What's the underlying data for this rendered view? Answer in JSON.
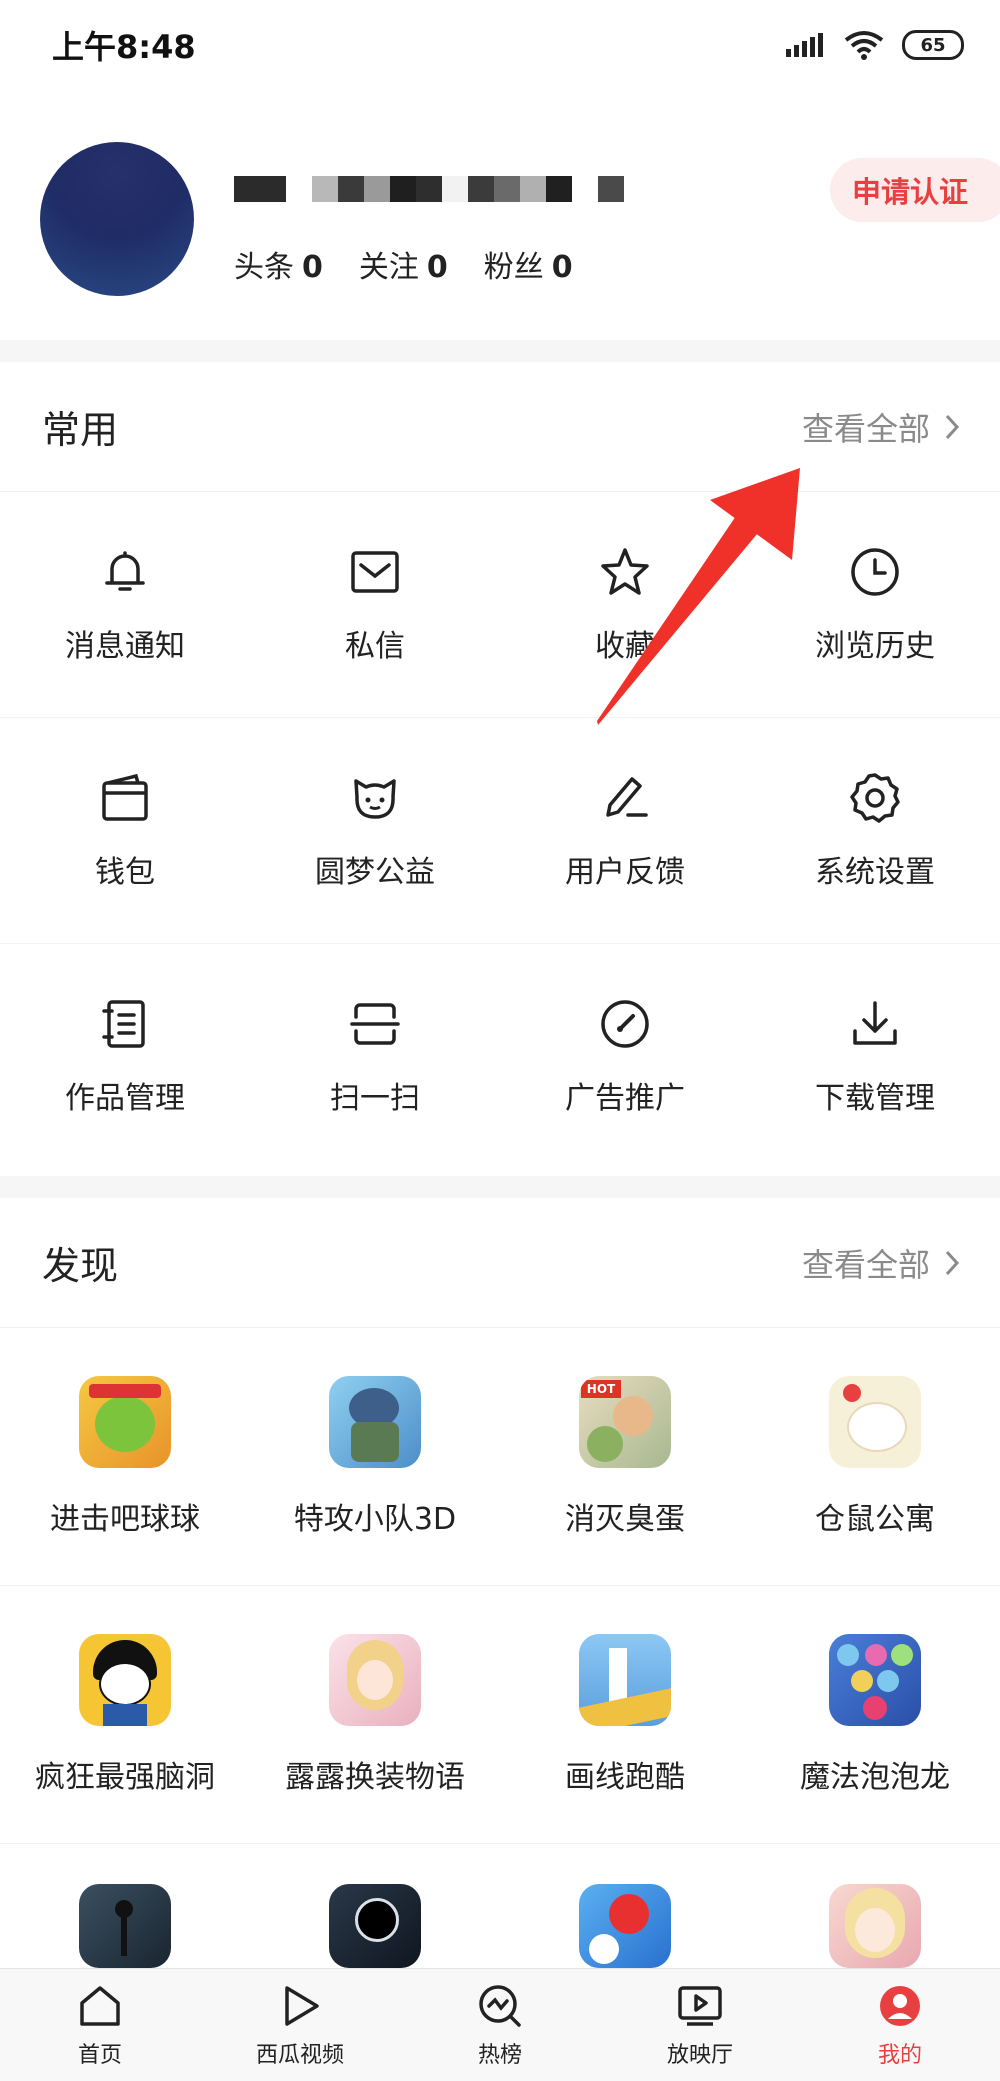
{
  "status": {
    "time": "上午8:48",
    "battery": "65"
  },
  "profile": {
    "stats": [
      {
        "label": "头条",
        "value": "0"
      },
      {
        "label": "关注",
        "value": "0"
      },
      {
        "label": "粉丝",
        "value": "0"
      }
    ],
    "verify_label": "申请认证"
  },
  "common": {
    "title": "常用",
    "see_all": "查看全部",
    "rows": [
      [
        {
          "label": "消息通知",
          "icon": "bell-icon"
        },
        {
          "label": "私信",
          "icon": "mail-icon"
        },
        {
          "label": "收藏",
          "icon": "star-icon"
        },
        {
          "label": "浏览历史",
          "icon": "clock-icon"
        }
      ],
      [
        {
          "label": "钱包",
          "icon": "wallet-icon"
        },
        {
          "label": "圆梦公益",
          "icon": "charity-icon"
        },
        {
          "label": "用户反馈",
          "icon": "feedback-icon"
        },
        {
          "label": "系统设置",
          "icon": "gear-icon"
        }
      ],
      [
        {
          "label": "作品管理",
          "icon": "notebook-icon"
        },
        {
          "label": "扫一扫",
          "icon": "scan-icon"
        },
        {
          "label": "广告推广",
          "icon": "gauge-icon"
        },
        {
          "label": "下载管理",
          "icon": "download-icon"
        }
      ]
    ]
  },
  "discover": {
    "title": "发现",
    "see_all": "查看全部",
    "rows": [
      [
        {
          "label": "进击吧球球",
          "color": "#f0b93a"
        },
        {
          "label": "特攻小队3D",
          "color": "#5aa0d8"
        },
        {
          "label": "消灭臭蛋",
          "color": "#d9c5a0"
        },
        {
          "label": "仓鼠公寓",
          "color": "#f5e9c8"
        }
      ],
      [
        {
          "label": "疯狂最强脑洞",
          "color": "#f6c533"
        },
        {
          "label": "露露换装物语",
          "color": "#f2c6cf"
        },
        {
          "label": "画线跑酷",
          "color": "#7fb9e8"
        },
        {
          "label": "魔法泡泡龙",
          "color": "#3a6fcf"
        }
      ],
      [
        {
          "label": "",
          "color": "#2a3a4a"
        },
        {
          "label": "",
          "color": "#1c2838"
        },
        {
          "label": "",
          "color": "#3a8fe0"
        },
        {
          "label": "",
          "color": "#f0c8c0"
        }
      ]
    ]
  },
  "tabbar": [
    {
      "label": "首页",
      "icon": "home-icon"
    },
    {
      "label": "西瓜视频",
      "icon": "play-icon"
    },
    {
      "label": "热榜",
      "icon": "trending-icon"
    },
    {
      "label": "放映厅",
      "icon": "theater-icon"
    },
    {
      "label": "我的",
      "icon": "profile-icon",
      "active": true
    }
  ],
  "colors": {
    "accent": "#e84040",
    "arrow": "#f0312a"
  }
}
